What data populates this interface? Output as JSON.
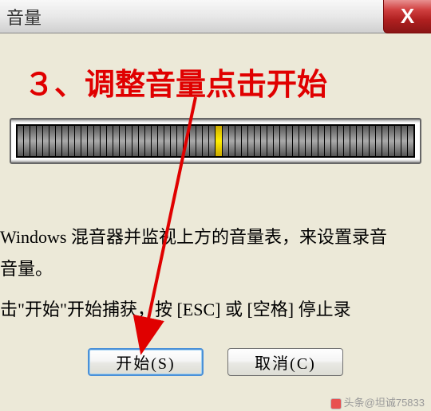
{
  "titlebar": {
    "title": "音量",
    "close_label": "X"
  },
  "annotation": {
    "text": "３、调整音量点击开始"
  },
  "instructions": {
    "line1": "Windows 混音器并监视上方的音量表，来设置录音",
    "line2": "音量。",
    "line3": "击\"开始\"开始捕获，按 [ESC] 或 [空格] 停止录"
  },
  "buttons": {
    "start": "开始(S)",
    "cancel": "取消(C)"
  },
  "watermark": {
    "text": "头条@坦诚75833"
  },
  "meter": {
    "peak_index": 31,
    "total_bars": 62
  }
}
